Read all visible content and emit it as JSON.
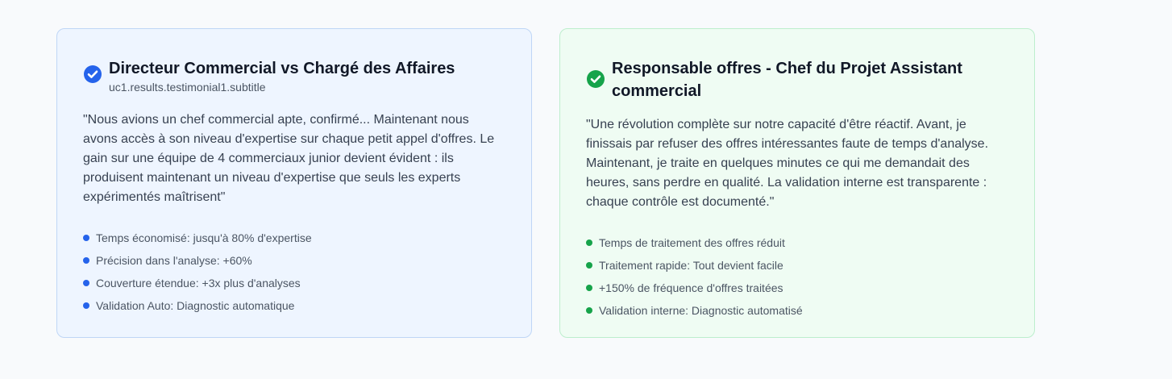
{
  "colors": {
    "page_bg": "#f8fafc",
    "blue_accent": "#2563eb",
    "green_accent": "#16a34a",
    "blue_card_bg": "#eef5ff",
    "green_card_bg": "#effcf3"
  },
  "testimonials": [
    {
      "icon": "check-circle-icon",
      "title": "Directeur Commercial vs Chargé des Affaires",
      "subtitle": "uc1.results.testimonial1.subtitle",
      "quote": "\"Nous avions un chef commercial apte, confirmé... Maintenant nous avons accès à son niveau d'expertise sur chaque petit appel d'offres. Le gain sur une équipe de 4 commerciaux junior devient évident : ils produisent maintenant un niveau d'expertise que seuls les experts expérimentés maîtrisent\"",
      "points": [
        "Temps économisé: jusqu'à 80% d'expertise",
        "Précision dans l'analyse: +60%",
        "Couverture étendue: +3x plus d'analyses",
        "Validation Auto: Diagnostic automatique"
      ]
    },
    {
      "icon": "check-circle-icon",
      "title": "Responsable offres - Chef du Projet Assistant commercial",
      "subtitle": "",
      "quote": "\"Une révolution complète sur notre capacité d'être réactif. Avant, je finissais par refuser des offres intéressantes faute de temps d'analyse. Maintenant, je traite en quelques minutes ce qui me demandait des heures, sans perdre en qualité. La validation interne est transparente : chaque contrôle est documenté.\"",
      "points": [
        "Temps de traitement des offres réduit",
        "Traitement rapide: Tout devient facile",
        "+150% de fréquence d'offres traitées",
        "Validation interne: Diagnostic automatisé"
      ]
    }
  ]
}
